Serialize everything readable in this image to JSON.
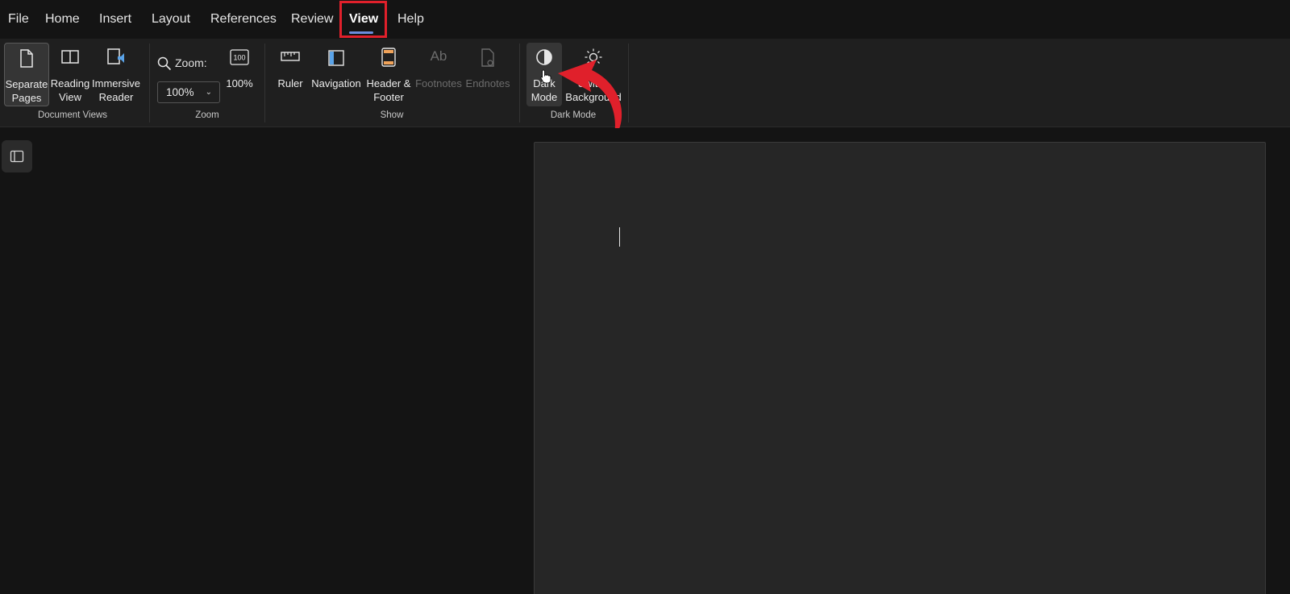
{
  "menu": {
    "tabs": [
      "File",
      "Home",
      "Insert",
      "Layout",
      "References",
      "Review",
      "View",
      "Help"
    ],
    "active_tab": "View"
  },
  "ribbon": {
    "document_views": {
      "label": "Document Views",
      "separate_pages": [
        "Separate",
        "Pages"
      ],
      "reading_view": [
        "Reading",
        "View"
      ],
      "immersive_reader": [
        "Immersive",
        "Reader"
      ]
    },
    "zoom": {
      "label": "Zoom",
      "zoom_text": "Zoom:",
      "zoom_value": "100%",
      "hundred_percent": "100%",
      "hundred_icon_text": "100"
    },
    "show": {
      "label": "Show",
      "ruler": "Ruler",
      "navigation": "Navigation",
      "header_footer": [
        "Header &",
        "Footer"
      ],
      "footnotes": "Footnotes",
      "endnotes": "Endnotes"
    },
    "dark_mode": {
      "label": "Dark Mode",
      "dark_mode_btn": [
        "Dark",
        "Mode"
      ],
      "switch_background": [
        "Switch",
        "Background"
      ]
    }
  },
  "colors": {
    "highlight_red": "#e0202b",
    "tab_underline": "#6a8dde",
    "background": "#141414",
    "ribbon": "#1f1f1f",
    "page": "#262626"
  }
}
